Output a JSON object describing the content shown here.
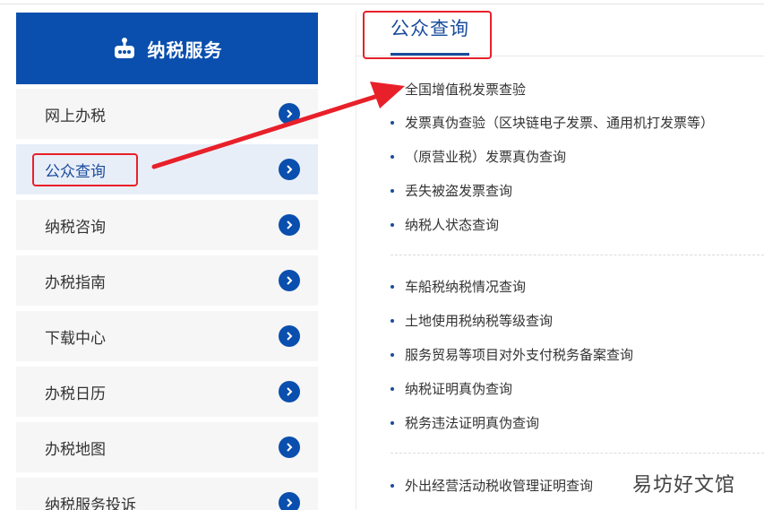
{
  "sidebar": {
    "title": "纳税服务",
    "items": [
      {
        "label": "网上办税"
      },
      {
        "label": "公众查询"
      },
      {
        "label": "纳税咨询"
      },
      {
        "label": "办税指南"
      },
      {
        "label": "下载中心"
      },
      {
        "label": "办税日历"
      },
      {
        "label": "办税地图"
      },
      {
        "label": "纳税服务投诉"
      }
    ]
  },
  "main": {
    "title": "公众查询",
    "groups": [
      [
        "全国增值税发票查验",
        "发票真伪查验（区块链电子发票、通用机打发票等）",
        "（原营业税）发票真伪查询",
        "丢失被盗发票查询",
        "纳税人状态查询"
      ],
      [
        "车船税纳税情况查询",
        "土地使用税纳税等级查询",
        "服务贸易等项目对外支付税务备案查询",
        "纳税证明真伪查询",
        "税务违法证明真伪查询"
      ],
      [
        "外出经营活动税收管理证明查询"
      ]
    ]
  },
  "colors": {
    "accent": "#0a4fae",
    "annotation": "#e8202a"
  },
  "watermark": "易坊好文馆"
}
